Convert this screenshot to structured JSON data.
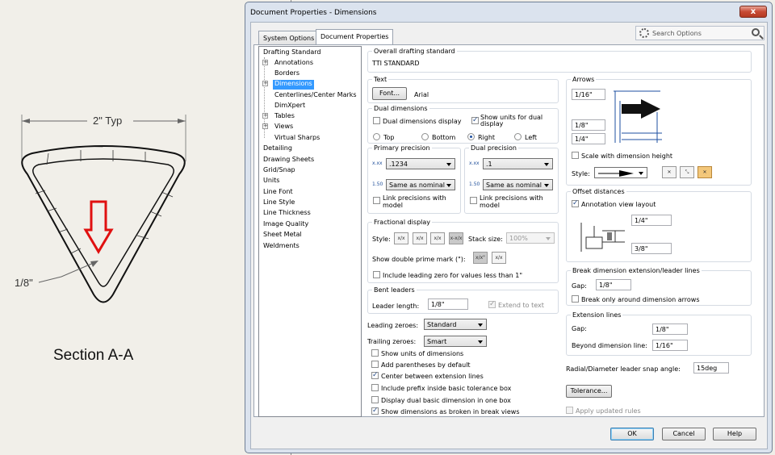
{
  "drawing": {
    "dim_top": "2\" Typ",
    "dim_left": "1/8\"",
    "section_label": "Section A-A",
    "arrow_color": "#e01010"
  },
  "dialog": {
    "title": "Document Properties - Dimensions",
    "close_glyph": "x",
    "tabs": [
      "System Options",
      "Document Properties"
    ],
    "active_tab": "Document Properties",
    "search_placeholder": "Search Options"
  },
  "tree": {
    "items": [
      {
        "label": "Drafting Standard",
        "level": 0
      },
      {
        "label": "Annotations",
        "level": 1,
        "expander": "+"
      },
      {
        "label": "Borders",
        "level": 1
      },
      {
        "label": "Dimensions",
        "level": 1,
        "expander": "+",
        "selected": true
      },
      {
        "label": "Centerlines/Center Marks",
        "level": 1
      },
      {
        "label": "DimXpert",
        "level": 1
      },
      {
        "label": "Tables",
        "level": 1,
        "expander": "+"
      },
      {
        "label": "Views",
        "level": 1,
        "expander": "+"
      },
      {
        "label": "Virtual Sharps",
        "level": 1
      },
      {
        "label": "Detailing",
        "level": 0
      },
      {
        "label": "Drawing Sheets",
        "level": 0
      },
      {
        "label": "Grid/Snap",
        "level": 0
      },
      {
        "label": "Units",
        "level": 0
      },
      {
        "label": "Line Font",
        "level": 0
      },
      {
        "label": "Line Style",
        "level": 0
      },
      {
        "label": "Line Thickness",
        "level": 0
      },
      {
        "label": "Image Quality",
        "level": 0
      },
      {
        "label": "Sheet Metal",
        "level": 0
      },
      {
        "label": "Weldments",
        "level": 0
      }
    ]
  },
  "overall": {
    "group_label": "Overall drafting standard",
    "value": "TTI STANDARD"
  },
  "text": {
    "group_label": "Text",
    "font_button": "Font...",
    "font_name": "Arial"
  },
  "dual": {
    "group_label": "Dual dimensions",
    "display_label": "Dual dimensions display",
    "display_checked": false,
    "show_units_label_1": "Show units for dual",
    "show_units_label_2": "display",
    "show_units_checked": true,
    "positions": [
      "Top",
      "Bottom",
      "Right",
      "Left"
    ],
    "selected_position": "Right"
  },
  "primary": {
    "group_label": "Primary precision",
    "value": ".1234",
    "tolerance": "Same as nominal",
    "link_label_1": "Link precisions with",
    "link_label_2": "model",
    "link_checked": false
  },
  "dual_precision": {
    "group_label": "Dual precision",
    "value": ".1",
    "tolerance": "Same as nominal",
    "link_label_1": "Link precisions with",
    "link_label_2": "model",
    "link_checked": false
  },
  "fractional": {
    "group_label": "Fractional display",
    "style_label": "Style:",
    "style_icons": [
      "x/x",
      "x/x",
      "x/x",
      "x-x/x"
    ],
    "stack_label": "Stack size:",
    "stack_value": "100%",
    "double_prime_label": "Show double prime mark (\"):",
    "double_prime_icons": [
      "x/x\"",
      "x/x"
    ],
    "leading_zero_label": "Include leading zero for values less than 1\"",
    "leading_zero_checked": false
  },
  "bent": {
    "group_label": "Bent leaders",
    "length_label": "Leader length:",
    "length_value": "1/8\"",
    "extend_label": "Extend to text",
    "extend_checked": true
  },
  "zeroes": {
    "leading_label": "Leading zeroes:",
    "leading_value": "Standard",
    "trailing_label": "Trailing zeroes:",
    "trailing_value": "Smart"
  },
  "options": [
    {
      "label": "Show units of dimensions",
      "checked": false
    },
    {
      "label": "Add parentheses by default",
      "checked": false
    },
    {
      "label": "Center between extension lines",
      "checked": true
    },
    {
      "label": "Include prefix inside basic tolerance box",
      "checked": false
    },
    {
      "label": "Display dual basic dimension in one box",
      "checked": false
    },
    {
      "label": "Show dimensions as broken in break views",
      "checked": true
    }
  ],
  "arrows": {
    "group_label": "Arrows",
    "size1": "1/16\"",
    "size2": "1/8\"",
    "size3": "1/4\"",
    "scale_label": "Scale with dimension height",
    "scale_checked": false,
    "style_label": "Style:"
  },
  "offset": {
    "group_label": "Offset distances",
    "annotation_label": "Annotation view layout",
    "annotation_checked": true,
    "d1": "1/4\"",
    "d2": "3/8\""
  },
  "break_dim": {
    "group_label": "Break dimension extension/leader lines",
    "gap_label": "Gap:",
    "gap_value": "1/8\"",
    "around_label": "Break only around dimension arrows",
    "around_checked": false
  },
  "extension": {
    "group_label": "Extension lines",
    "gap_label": "Gap:",
    "gap_value": "1/8\"",
    "beyond_label": "Beyond dimension line:",
    "beyond_value": "1/16\""
  },
  "snap": {
    "label": "Radial/Diameter leader snap angle:",
    "value": "15deg"
  },
  "tolerance_button": "Tolerance...",
  "apply_updated": {
    "label": "Apply updated rules",
    "checked": false
  },
  "footer": {
    "ok": "OK",
    "cancel": "Cancel",
    "help": "Help"
  }
}
